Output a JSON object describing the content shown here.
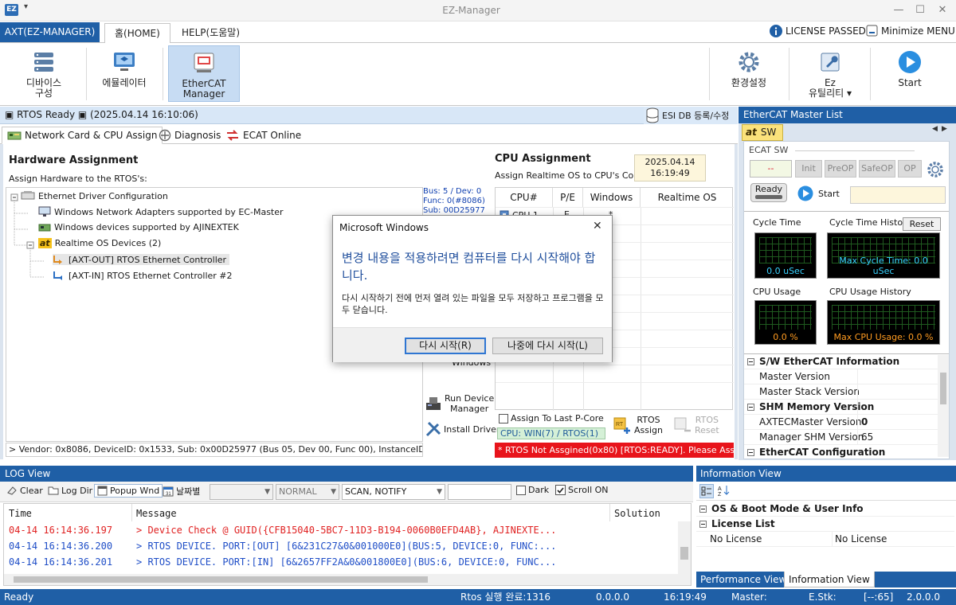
{
  "window": {
    "title": "EZ-Manager",
    "app_icon": "EZ",
    "qa_dropdown": "▾",
    "min": "—",
    "max": "☐",
    "close": "✕"
  },
  "tabs": {
    "app_label": "AXT(EZ-MANAGER)",
    "home": "홈(HOME)",
    "help": "HELP(도움말)"
  },
  "right_status": {
    "license": "LICENSE PASSED",
    "minimize_menu": "Minimize MENU"
  },
  "ribbon": {
    "device_config": [
      "디바이스",
      "구성"
    ],
    "emulator": "에뮬레이터",
    "ethercat_manager": [
      "EtherCAT",
      "Manager"
    ],
    "settings": "환경설정",
    "ez_utility": [
      "Ez",
      "유틸리티 ▾"
    ],
    "start": "Start"
  },
  "status_line": {
    "text": "▣ RTOS Ready ▣ (2025.04.14 16:10:06)",
    "esi_db": "ESI DB 등록/수정"
  },
  "subtabs": {
    "network_card": "Network Card & CPU Assign",
    "diagnosis": "Diagnosis",
    "ecat_online": "ECAT Online"
  },
  "hardware": {
    "title": "Hardware Assignment",
    "subtitle": "Assign Hardware to the RTOS's:",
    "tree": [
      {
        "label": "Ethernet Driver Configuration",
        "icon": "network-card-icon"
      },
      {
        "label": "Windows Network Adapters supported by EC-Master",
        "icon": "monitor-icon"
      },
      {
        "label": "Windows devices supported by AJINEXTEK",
        "icon": "pci-card-icon"
      },
      {
        "label": "Realtime OS Devices (2)",
        "icon": "at-logo-icon"
      },
      {
        "label": "[AXT-OUT] RTOS Ethernet Controller",
        "icon": "out-port-icon"
      },
      {
        "label": "[AXT-IN] RTOS Ethernet Controller #2",
        "icon": "in-port-icon"
      }
    ],
    "bus_info": [
      "Bus: 5 / Dev: 0",
      "Func: 0(#8086)",
      "Sub: 00D25977"
    ],
    "vendor": "> Vendor: 0x8086, DeviceID: 0x1533, Sub: 0x00D25977 (Bus 05, Dev 00, Func 00), InstanceID: PCI\\VEN_"
  },
  "cpu": {
    "title": "CPU Assignment",
    "subtitle": "Assign Realtime OS to CPU's Core:",
    "date": "2025.04.14",
    "time": "16:19:49",
    "headers": [
      "CPU#",
      "P/E",
      "Windows",
      "Realtime OS"
    ],
    "row1": {
      "cpu": "CPU 1",
      "pe": "E",
      "win": "*"
    },
    "windows_fragment": "Windows",
    "run_device": [
      "Run Device",
      "Manager"
    ],
    "install_driver": "Install Driver",
    "assign_last": "Assign To Last P-Core",
    "assign_btn": [
      "RTOS",
      "Assign"
    ],
    "reset_btn": [
      "RTOS",
      "Reset"
    ],
    "cpu_win": "CPU: WIN(7) / RTOS(1)",
    "error": "* RTOS Not Assgined(0x80) [RTOS:READY]. Please Assign CPU"
  },
  "master_list": {
    "title": "EtherCAT Master List",
    "tab": "SW",
    "tab_logo": "at",
    "nav_left": "◀",
    "nav_right": "▶",
    "group": "ECAT SW",
    "state": "--",
    "buttons": [
      "Init",
      "PreOP",
      "SafeOP",
      "OP"
    ],
    "ready": "Ready",
    "start": "Start",
    "cycle_time": "Cycle Time",
    "cycle_hist": "Cycle Time History",
    "reset": "Reset",
    "cycle_val": "0.0 uSec",
    "cycle_max": "Max Cycle Time: 0.0 uSec",
    "cpu_usage": "CPU Usage",
    "cpu_hist": "CPU Usage History",
    "cpu_val": "0.0 %",
    "cpu_max": "Max CPU Usage: 0.0 %",
    "props": [
      {
        "section": "S/W EtherCAT Information"
      },
      {
        "key": "Master Version",
        "val": ""
      },
      {
        "key": "Master Stack Version",
        "val": ""
      },
      {
        "section": "SHM Memory Version"
      },
      {
        "key": "AXTECMaster Version",
        "val": "0"
      },
      {
        "key": "Manager SHM Version",
        "val": "65"
      },
      {
        "section": "EtherCAT Configuration"
      }
    ]
  },
  "log": {
    "title": "LOG View",
    "clear": "Clear",
    "logdir": "Log Dir",
    "popup": "Popup Wnd",
    "date_btn": "날짜별",
    "combo1": "",
    "combo2": "NORMAL",
    "combo3": "SCAN, NOTIFY",
    "combo4": "",
    "dark": "Dark",
    "scroll_on": "Scroll ON",
    "headers": [
      "Time",
      "Message",
      "Solution"
    ],
    "lines": [
      {
        "time": "04-14 16:14:36.197",
        "msg": "> Device Check @ GUID({CFB15040-5BC7-11D3-B194-0060B0EFD4AB}, AJINEXTE..."
      },
      {
        "time": "04-14 16:14:36.200",
        "msg": "> RTOS DEVICE. PORT:[OUT] [6&231C27&0&001000E0](BUS:5, DEVICE:0, FUNC:..."
      },
      {
        "time": "04-14 16:14:36.201",
        "msg": "> RTOS DEVICE. PORT:[IN] [6&2657FF2A&0&001800E0](BUS:6, DEVICE:0, FUNC..."
      }
    ]
  },
  "info": {
    "title": "Information View",
    "rows": [
      {
        "section": "OS & Boot Mode & User Info"
      },
      {
        "section": "License List"
      },
      {
        "key": "No License",
        "val": "No License"
      }
    ],
    "tab_perf": "Performance View",
    "tab_info": "Information View"
  },
  "statusbar": {
    "ready": "Ready",
    "rtos": "Rtos 실행 완료:1316",
    "ver": "0.0.0.0",
    "time": "16:19:49",
    "master": "Master:",
    "estk": "E.Stk:",
    "code": "[--:65]",
    "appver": "2.0.0.0"
  },
  "dialog": {
    "title": "Microsoft Windows",
    "close": "✕",
    "heading": "변경 내용을 적용하려면 컴퓨터를 다시 시작해야 합니다.",
    "body": "다시 시작하기 전에 먼저 열려 있는 파일을 모두 저장하고 프로그램을 모두 닫습니다.",
    "restart_now": "다시 시작(R)",
    "restart_later": "나중에 다시 시작(L)"
  },
  "colors": {
    "accent": "#1f5fa6",
    "error": "#e8141b",
    "scope_green": "#38d2ff",
    "scope_orange": "#ff9b21"
  }
}
